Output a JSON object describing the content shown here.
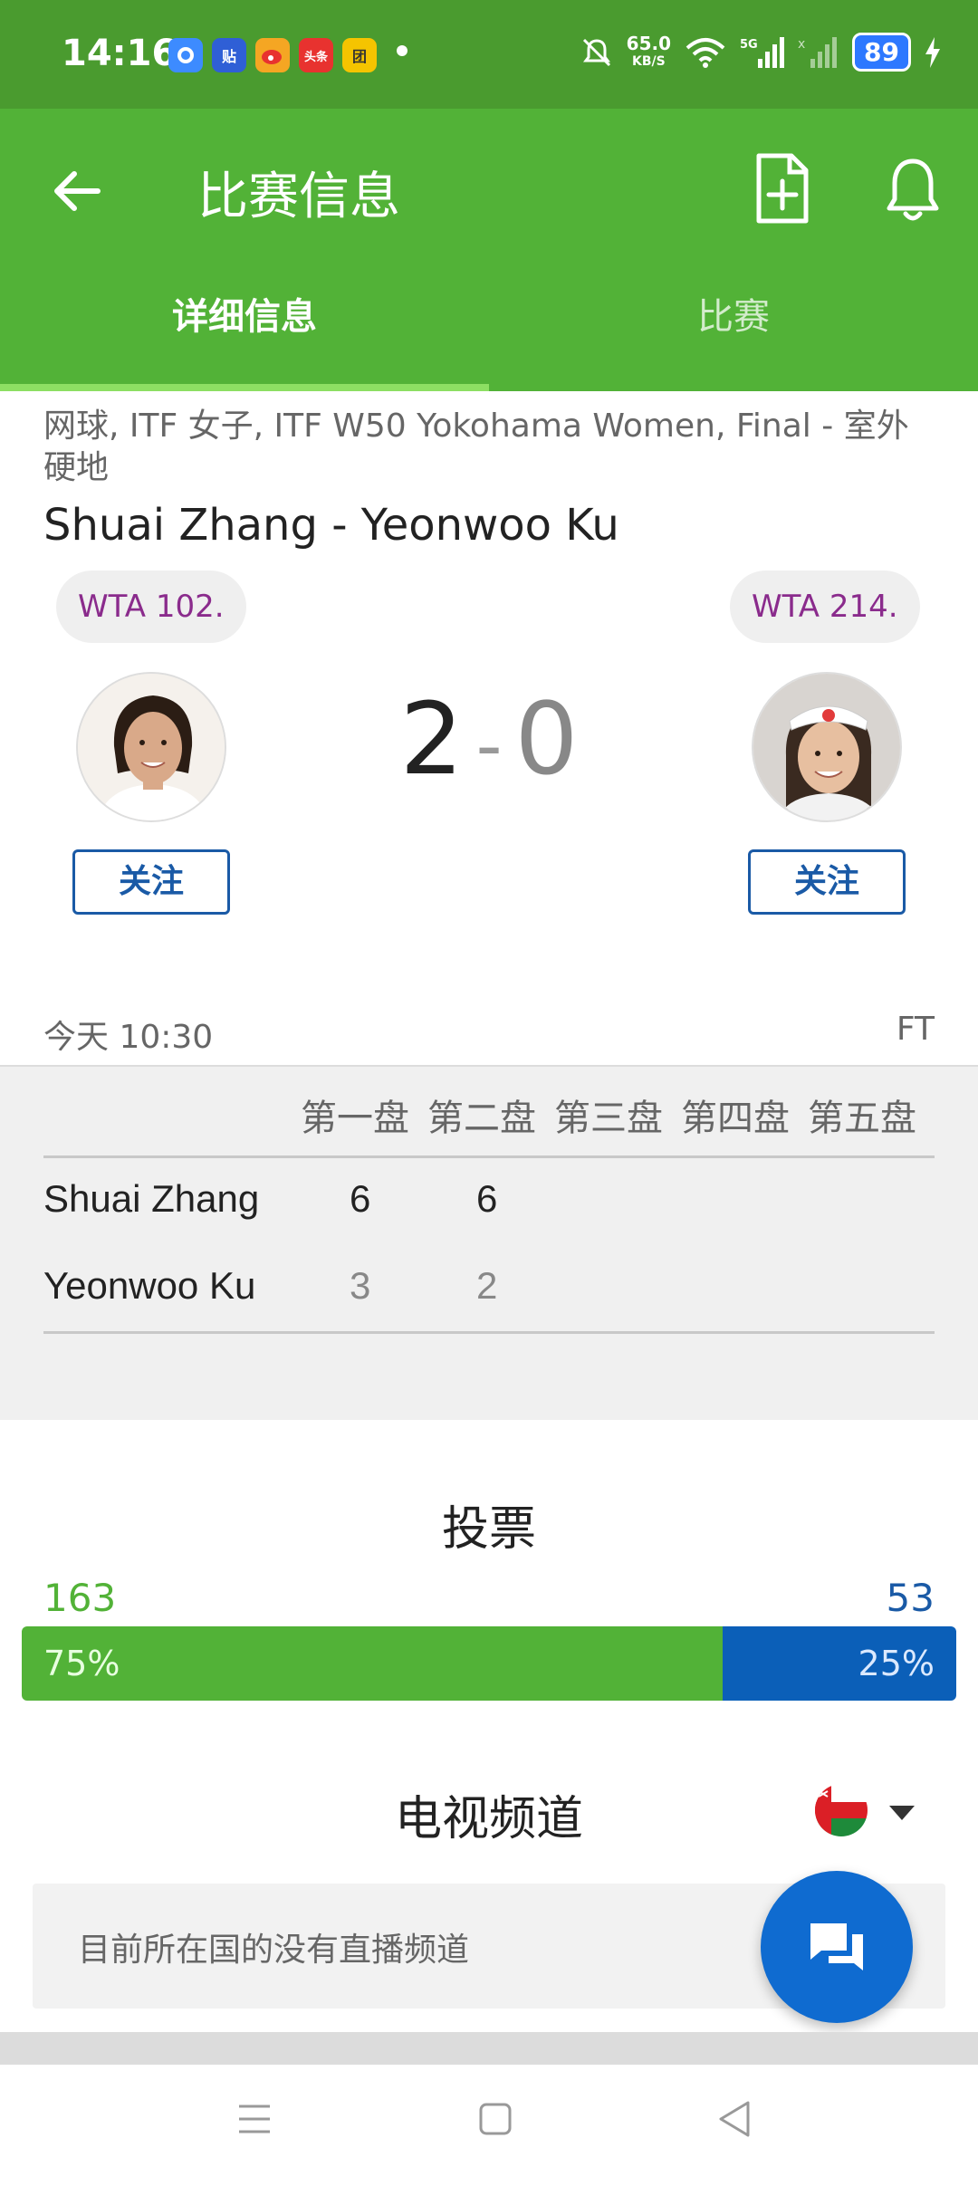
{
  "status_bar": {
    "time": "14:16",
    "net_speed": "65.0",
    "net_speed_unit": "KB/S",
    "signal_label": "5G",
    "battery": "89",
    "apps": [
      {
        "name": "app-a",
        "color": "#3d8bff",
        "glyph": ""
      },
      {
        "name": "app-tieba",
        "color": "#2f5fd6",
        "glyph": "贴"
      },
      {
        "name": "app-weibo",
        "color": "#e8322f",
        "glyph": ""
      },
      {
        "name": "app-toutiao",
        "color": "#e8322f",
        "glyph": "头条"
      },
      {
        "name": "app-meituan",
        "color": "#f5c400",
        "glyph": "团"
      }
    ]
  },
  "app_bar": {
    "title": "比赛信息",
    "tabs": [
      {
        "label": "详细信息",
        "active": true
      },
      {
        "label": "比赛",
        "active": false
      }
    ]
  },
  "match": {
    "breadcrumb": "网球, ITF 女子, ITF W50 Yokohama Women, Final - 室外硬地",
    "title": "Shuai Zhang - Yeonwoo Ku",
    "home": {
      "name": "Shuai Zhang",
      "rank": "WTA 102.",
      "follow_label": "关注"
    },
    "away": {
      "name": "Yeonwoo Ku",
      "rank": "WTA 214.",
      "follow_label": "关注"
    },
    "score_home": "2",
    "score_sep": "-",
    "score_away": "0",
    "time": "今天 10:30",
    "status": "FT"
  },
  "sets": {
    "headers": [
      "第一盘",
      "第二盘",
      "第三盘",
      "第四盘",
      "第五盘"
    ],
    "rows": [
      {
        "player": "Shuai Zhang",
        "scores": [
          "6",
          "6"
        ]
      },
      {
        "player": "Yeonwoo Ku",
        "scores": [
          "3",
          "2"
        ]
      }
    ]
  },
  "votes": {
    "title": "投票",
    "home_count": "163",
    "away_count": "53",
    "home_pct": "75%",
    "away_pct": "25%",
    "home_fraction": 0.75,
    "colors": {
      "home": "#52b237",
      "away": "#0b5fb8"
    }
  },
  "tv": {
    "title": "电视频道",
    "empty_text": "目前所在国的没有直播频道",
    "flag_icon": "oman-flag-icon"
  },
  "colors": {
    "primary": "#52b237",
    "status_bar": "#4a9b2f",
    "accent_blue": "#1a5aa6",
    "rank_text": "#8a2b8c"
  }
}
